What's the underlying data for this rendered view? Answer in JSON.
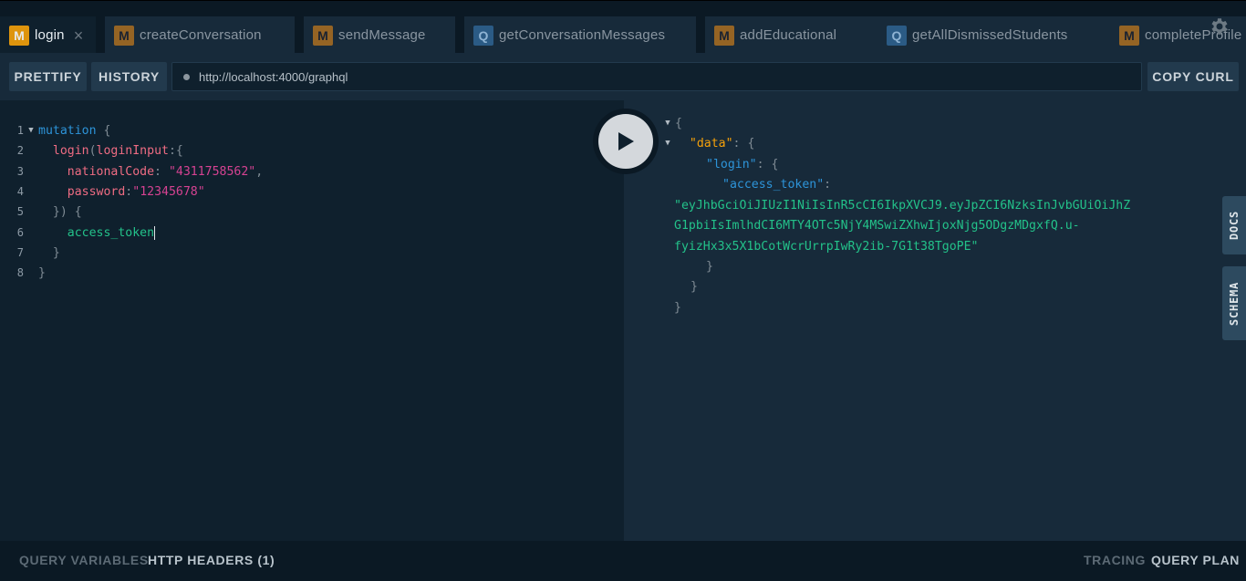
{
  "tabs": [
    {
      "type": "M",
      "label": "login",
      "active": true,
      "closable": true
    },
    {
      "type": "M",
      "label": "createConversation"
    },
    {
      "type": "M",
      "label": "sendMessage"
    },
    {
      "type": "Q",
      "label": "getConversationMessages"
    },
    {
      "type": "M",
      "label": "addEducational"
    },
    {
      "type": "Q",
      "label": "getAllDismissedStudents"
    },
    {
      "type": "M",
      "label": "completeProfile"
    }
  ],
  "toolbar": {
    "prettify": "PRETTIFY",
    "history": "HISTORY",
    "url": "http://localhost:4000/graphql",
    "copy_curl": "COPY CURL"
  },
  "editor": {
    "line_numbers": [
      "1",
      "2",
      "3",
      "4",
      "5",
      "6",
      "7",
      "8"
    ],
    "l1_kw": "mutation",
    "l1_brace": "{",
    "l2_fn": "login",
    "l2_open": "(",
    "l2_arg": "loginInput",
    "l2_colon": ":{",
    "l3_key": "nationalCode",
    "l3_colon": ":",
    "l3_val": "\"4311758562\"",
    "l3_comma": ",",
    "l4_key": "password",
    "l4_colon": ":",
    "l4_val": "\"12345678\"",
    "l5_close": "})",
    "l5_brace": "{",
    "l6_field": "access_token",
    "l7_close": "}",
    "l8_close": "}"
  },
  "result": {
    "open": "{",
    "data_key": "\"data\"",
    "data_colon": ":",
    "data_brace": "{",
    "login_key": "\"login\"",
    "login_colon": ":",
    "login_brace": "{",
    "token_key": "\"access_token\"",
    "token_colon": ":",
    "token_line1": "\"eyJhbGciOiJIUzI1NiIsInR5cCI6IkpXVCJ9.eyJpZCI6NzksInJvbGUiOiJhZ",
    "token_line2": "G1pbiIsImlhdCI6MTY4OTc5NjY4MSwiZXhwIjoxNjg5ODgzMDgxfQ.u-",
    "token_line3": "fyizHx3x5X1bCotWcrUrrpIwRy2ib-7G1t38TgoPE\"",
    "close1": "}",
    "close2": "}",
    "close3": "}"
  },
  "side_tabs": {
    "docs": "DOCS",
    "schema": "SCHEMA"
  },
  "bottom": {
    "query_variables": "QUERY VARIABLES",
    "http_headers": "HTTP HEADERS (1)",
    "tracing": "TRACING",
    "query_plan": "QUERY PLAN"
  },
  "colors": {
    "mutation_badge": "#f5a10a",
    "query_badge": "#2b5b85",
    "keyword": "#2d94d9",
    "string": "#d64292",
    "field": "#23c28a",
    "result_key": "#f5a10a"
  },
  "icons": [
    "gear-icon",
    "play-icon",
    "close-icon",
    "fold-arrow-icon"
  ]
}
